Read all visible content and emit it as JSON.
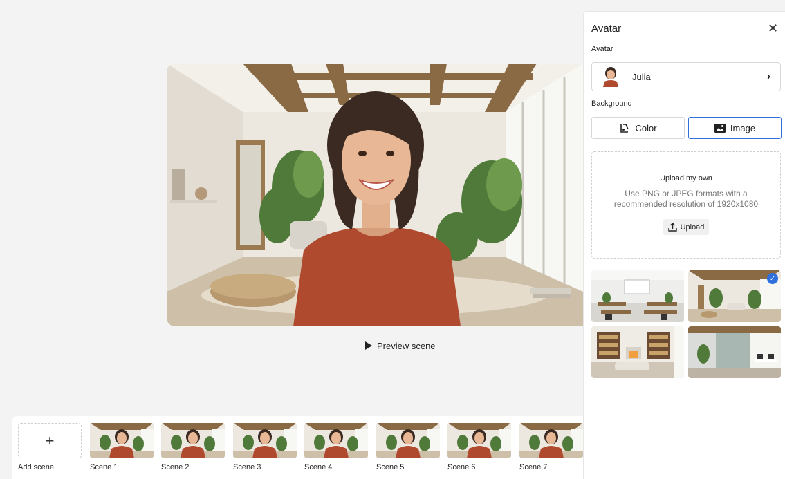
{
  "preview": {
    "button_label": "Preview scene"
  },
  "scenes": {
    "add_label": "Add scene",
    "add_symbol": "+",
    "items": [
      {
        "label": "Scene 1"
      },
      {
        "label": "Scene 2"
      },
      {
        "label": "Scene 3"
      },
      {
        "label": "Scene 4"
      },
      {
        "label": "Scene 5"
      },
      {
        "label": "Scene 6"
      },
      {
        "label": "Scene 7"
      }
    ]
  },
  "panel": {
    "title": "Avatar",
    "close_symbol": "✕",
    "avatar_section_label": "Avatar",
    "avatar_name": "Julia",
    "chevron_symbol": "›",
    "background_section_label": "Background",
    "tabs": {
      "color_label": "Color",
      "image_label": "Image",
      "active": "image"
    },
    "upload": {
      "title": "Upload my own",
      "description": "Use PNG or JPEG formats with a recommended resolution of 1920x1080",
      "button_label": "Upload"
    },
    "backgrounds": [
      {
        "name": "classroom",
        "selected": false
      },
      {
        "name": "living-room",
        "selected": true
      },
      {
        "name": "library-lounge",
        "selected": false
      },
      {
        "name": "office",
        "selected": false
      }
    ]
  },
  "colors": {
    "accent": "#2f6fde",
    "shirt": "#b04a2e",
    "wood": "#8a6a45"
  }
}
